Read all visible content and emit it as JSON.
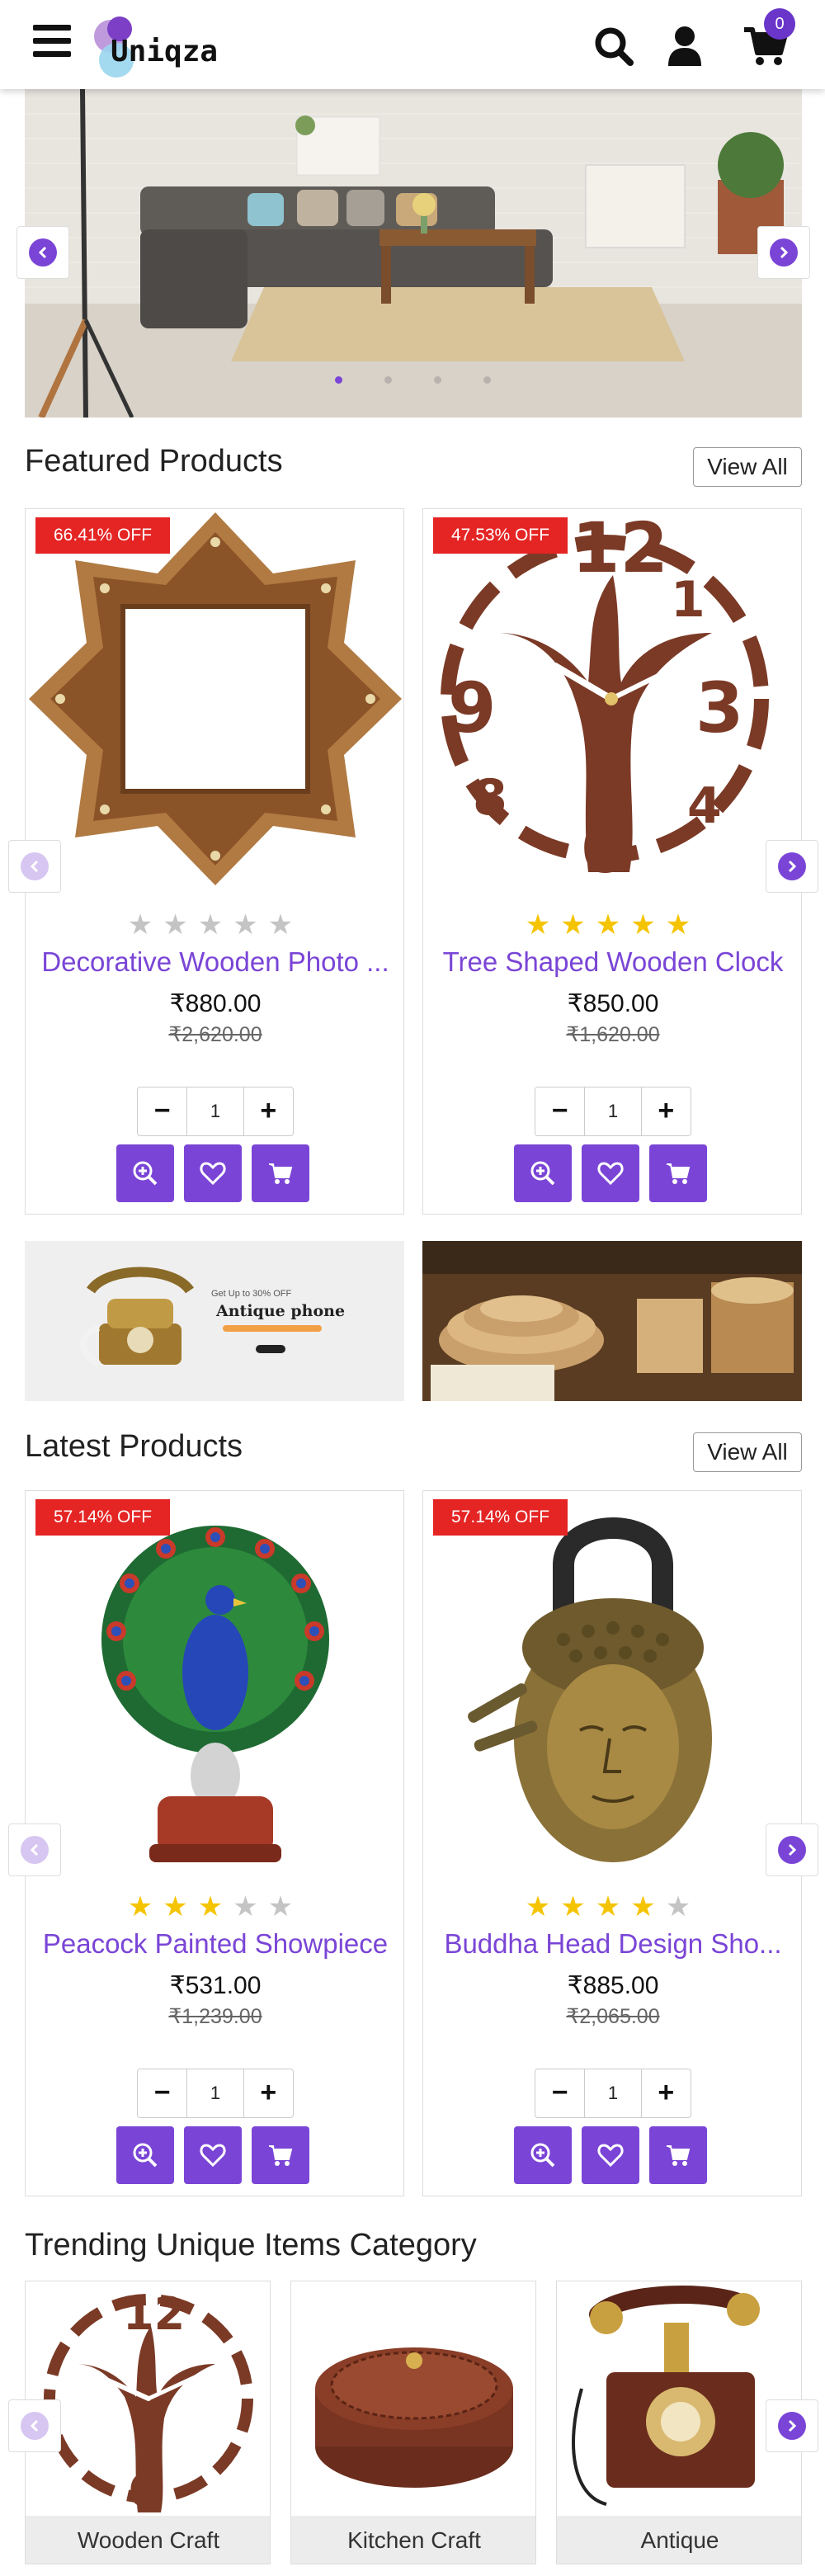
{
  "header": {
    "logo_text": "Uniqza",
    "cart_count": "0"
  },
  "banner": {
    "slide_count": 4,
    "active_slide": 1
  },
  "featured": {
    "title": "Featured Products",
    "view_all": "View All",
    "products": [
      {
        "badge": "66.41% OFF",
        "name": "Decorative Wooden Photo ...",
        "price": "₹880.00",
        "old_price": "₹2,620.00",
        "qty": "1",
        "rating": 0
      },
      {
        "badge": "47.53% OFF",
        "name": "Tree Shaped Wooden Clock",
        "price": "₹850.00",
        "old_price": "₹1,620.00",
        "qty": "1",
        "rating": 5
      }
    ]
  },
  "promos": {
    "antique_small": "Get Up to 30% OFF",
    "antique_title": "Antique phone"
  },
  "latest": {
    "title": "Latest Products",
    "view_all": "View All",
    "products": [
      {
        "badge": "57.14% OFF",
        "name": "Peacock Painted Showpiece",
        "price": "₹531.00",
        "old_price": "₹1,239.00",
        "qty": "1",
        "rating": 3
      },
      {
        "badge": "57.14% OFF",
        "name": "Buddha Head Design Sho...",
        "price": "₹885.00",
        "old_price": "₹2,065.00",
        "qty": "1",
        "rating": 4
      }
    ]
  },
  "trending": {
    "title": "Trending Unique Items Category",
    "categories": [
      "Wooden Craft",
      "Kitchen Craft",
      "Antique"
    ]
  },
  "colors": {
    "accent": "#7a45d6",
    "badge": "#e52424",
    "star_on": "#f5c400",
    "star_off": "#c4c4c4"
  },
  "icons": {
    "menu": "hamburger-icon",
    "search": "search-icon",
    "user": "user-icon",
    "cart": "cart-icon",
    "zoom": "zoom-in-icon",
    "wishlist": "heart-icon",
    "add_to_cart": "cart-icon"
  }
}
